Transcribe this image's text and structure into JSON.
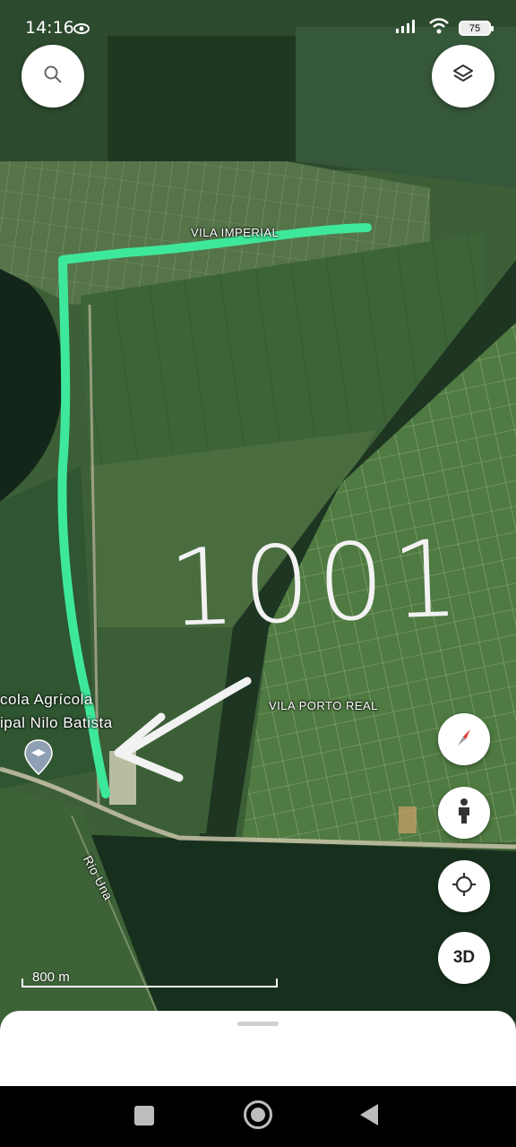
{
  "status_bar": {
    "time": "14:16",
    "battery": "75"
  },
  "map": {
    "labels": {
      "vila_imperial": "VILA IMPERIAL",
      "vila_porto_real": "VILA PORTO REAL",
      "school_line1": "cola Agrícola",
      "school_line2": "ipal Nilo Batista",
      "river": "Rio Una"
    },
    "annotation_text": "1001",
    "scale_label": "800 m",
    "colors": {
      "route": "#3ee89a",
      "annotation": "#f2f2f2",
      "forest": "#1f3a22",
      "field": "#3f6a3a"
    }
  },
  "buttons": {
    "search_icon": "search-icon",
    "layers_icon": "layers-icon",
    "compass_icon": "compass-icon",
    "person_icon": "person-icon",
    "locate_icon": "locate-icon",
    "three_d_label": "3D"
  }
}
